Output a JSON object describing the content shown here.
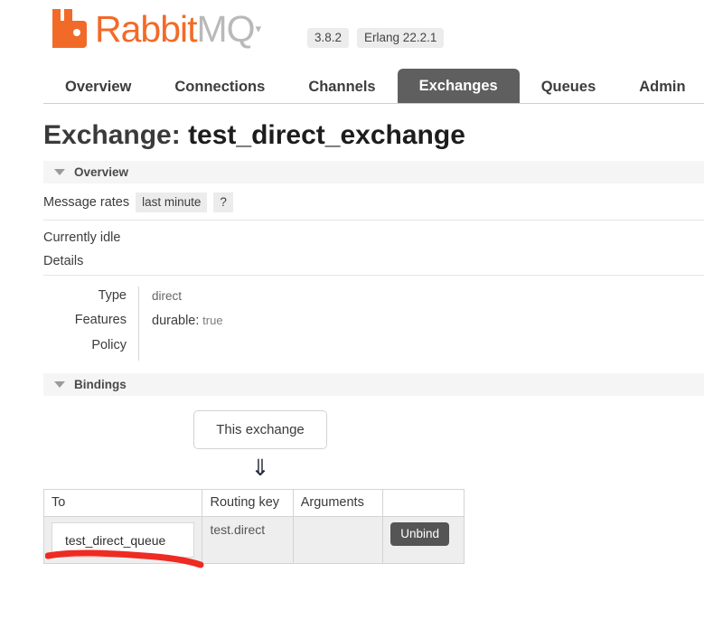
{
  "header": {
    "logo_primary": "Rabbit",
    "logo_secondary": "MQ",
    "logo_tm": "▾",
    "version": "3.8.2",
    "erlang_version": "Erlang 22.2.1"
  },
  "nav": {
    "items": [
      {
        "label": "Overview",
        "active": false
      },
      {
        "label": "Connections",
        "active": false
      },
      {
        "label": "Channels",
        "active": false
      },
      {
        "label": "Exchanges",
        "active": true
      },
      {
        "label": "Queues",
        "active": false
      },
      {
        "label": "Admin",
        "active": false
      }
    ]
  },
  "page": {
    "title_prefix": "Exchange: ",
    "exchange_name": "test_direct_exchange"
  },
  "overview": {
    "section_title": "Overview",
    "message_rates_label": "Message rates",
    "period_button": "last minute",
    "help_button": "?",
    "idle_text": "Currently idle",
    "details_label": "Details",
    "details": [
      {
        "label": "Type",
        "value": "direct"
      },
      {
        "label": "Features",
        "feature_name": "durable:",
        "feature_value": "true"
      },
      {
        "label": "Policy",
        "value": ""
      }
    ]
  },
  "bindings": {
    "section_title": "Bindings",
    "source_box_label": "This exchange",
    "arrow_glyph": "⇓",
    "columns": [
      "To",
      "Routing key",
      "Arguments",
      ""
    ],
    "rows": [
      {
        "to": "test_direct_queue",
        "routing_key": "test.direct",
        "arguments": "",
        "action_label": "Unbind"
      }
    ]
  },
  "annotation": {
    "color": "#ee2b22",
    "type": "hand-drawn-underline"
  }
}
